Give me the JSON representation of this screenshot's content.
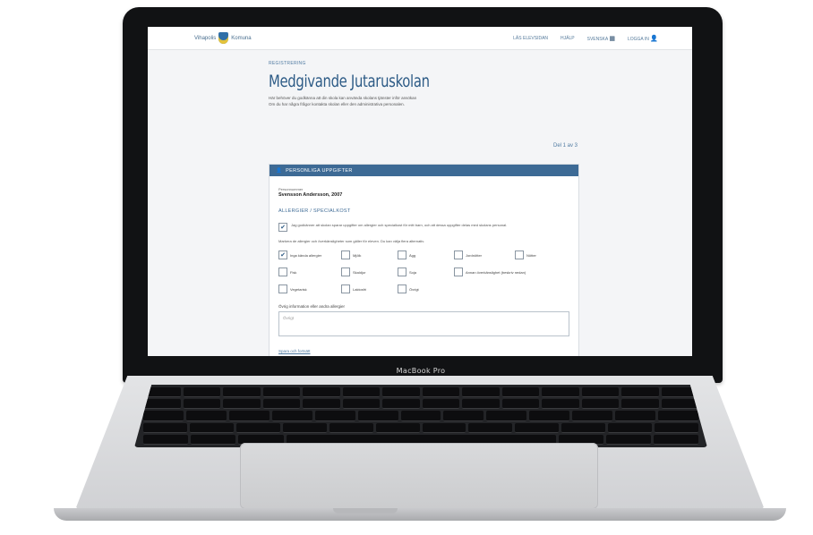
{
  "device": {
    "model_label": "MacBook Pro"
  },
  "header": {
    "brand_left": "Vihapolis",
    "brand_right": "Komuna",
    "nav": [
      "LÄS ELEVSIDAN",
      "HJÄLP",
      "SVENSKA",
      "LOGGA IN"
    ]
  },
  "page": {
    "breadcrumb": "Registrering",
    "title": "Medgivande Jutaruskolan",
    "intro_line1": "Här behöver du godkänna att din skola kan använda skolans tjänster inför ansökan",
    "intro_line2": "Om du har några frågor kontakta skolan eller den administrativa personalen.",
    "step": "Del 1 av 3"
  },
  "panel": {
    "header": "Personliga uppgifter",
    "person_label": "Personnummer",
    "person_value": "Svensson Andersson, 2007",
    "section": "Allergier / specialkost",
    "consent_text": "Jag godkänner att skolan sparar uppgifter om allergier och specialkost för mitt barn, och att dessa uppgifter delas med skolans personal.",
    "question": "Markera de allergier och överkänsligheter som gäller för eleven. Du kan välja flera alternativ.",
    "options": [
      {
        "label": "Inga kända allergier",
        "checked": true
      },
      {
        "label": "Mjölk",
        "checked": false
      },
      {
        "label": "Ägg",
        "checked": false
      },
      {
        "label": "Jordnötter",
        "checked": false
      },
      {
        "label": "Nötter",
        "checked": false
      },
      {
        "label": "Fisk",
        "checked": false
      },
      {
        "label": "Skaldjur",
        "checked": false
      },
      {
        "label": "Soja",
        "checked": false
      },
      {
        "label": "Annan överkänslighet (beskriv nedan)",
        "checked": false
      },
      {
        "label": "Vegetarisk",
        "checked": false
      },
      {
        "label": "Laktosfri",
        "checked": false
      },
      {
        "label": "Övrigt",
        "checked": false
      }
    ],
    "other_label": "Övrig information eller andra allergier",
    "other_placeholder": "Övrigt",
    "link": "Spara och fortsätt"
  },
  "colors": {
    "accent": "#3d6a95",
    "title": "#2d5b86"
  }
}
